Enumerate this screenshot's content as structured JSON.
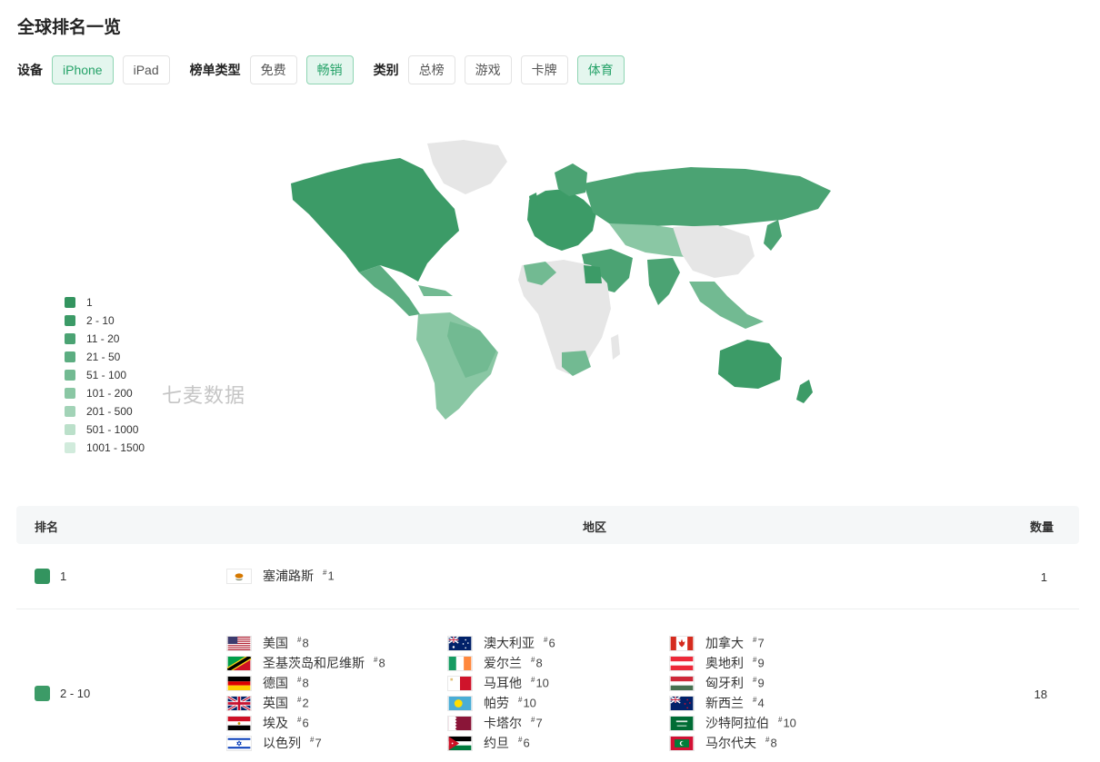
{
  "page": {
    "title": "全球排名一览"
  },
  "filters": {
    "device": {
      "label": "设备",
      "options": [
        "iPhone",
        "iPad"
      ],
      "active": 0
    },
    "chart_type": {
      "label": "榜单类型",
      "options": [
        "免费",
        "畅销"
      ],
      "active": 1
    },
    "category": {
      "label": "类别",
      "options": [
        "总榜",
        "游戏",
        "卡牌",
        "体育"
      ],
      "active": 3
    }
  },
  "legend": [
    {
      "label": "1",
      "color": "#33945f"
    },
    {
      "label": "2 - 10",
      "color": "#3c9b67"
    },
    {
      "label": "11 - 20",
      "color": "#4ba373"
    },
    {
      "label": "21 - 50",
      "color": "#5cad81"
    },
    {
      "label": "51 - 100",
      "color": "#72ba92"
    },
    {
      "label": "101 - 200",
      "color": "#8ac7a4"
    },
    {
      "label": "201 - 500",
      "color": "#a2d3b7"
    },
    {
      "label": "501 - 1000",
      "color": "#bbe0ca"
    },
    {
      "label": "1001 - 1500",
      "color": "#d1ebdc"
    }
  ],
  "watermark": "七麦数据",
  "table": {
    "headers": {
      "rank": "排名",
      "region": "地区",
      "count": "数量"
    },
    "rows": [
      {
        "rank": "1",
        "color": "#33945f",
        "count": "1",
        "countries": [
          {
            "name": "塞浦路斯",
            "rank": "1",
            "flag": "cyprus"
          }
        ]
      },
      {
        "rank": "2 - 10",
        "color": "#3c9b67",
        "count": "18",
        "countries": [
          {
            "name": "美国",
            "rank": "8",
            "flag": "usa"
          },
          {
            "name": "圣基茨岛和尼维斯",
            "rank": "8",
            "flag": "stkitts"
          },
          {
            "name": "德国",
            "rank": "8",
            "flag": "germany"
          },
          {
            "name": "英国",
            "rank": "2",
            "flag": "uk"
          },
          {
            "name": "埃及",
            "rank": "6",
            "flag": "egypt"
          },
          {
            "name": "以色列",
            "rank": "7",
            "flag": "israel"
          },
          {
            "name": "澳大利亚",
            "rank": "6",
            "flag": "australia"
          },
          {
            "name": "爱尔兰",
            "rank": "8",
            "flag": "ireland"
          },
          {
            "name": "马耳他",
            "rank": "10",
            "flag": "malta"
          },
          {
            "name": "帕劳",
            "rank": "10",
            "flag": "palau"
          },
          {
            "name": "卡塔尔",
            "rank": "7",
            "flag": "qatar"
          },
          {
            "name": "约旦",
            "rank": "6",
            "flag": "jordan"
          },
          {
            "name": "加拿大",
            "rank": "7",
            "flag": "canada"
          },
          {
            "name": "奥地利",
            "rank": "9",
            "flag": "austria"
          },
          {
            "name": "匈牙利",
            "rank": "9",
            "flag": "hungary"
          },
          {
            "name": "新西兰",
            "rank": "4",
            "flag": "newzealand"
          },
          {
            "name": "沙特阿拉伯",
            "rank": "10",
            "flag": "saudi"
          },
          {
            "name": "马尔代夫",
            "rank": "8",
            "flag": "maldives"
          }
        ]
      }
    ]
  }
}
